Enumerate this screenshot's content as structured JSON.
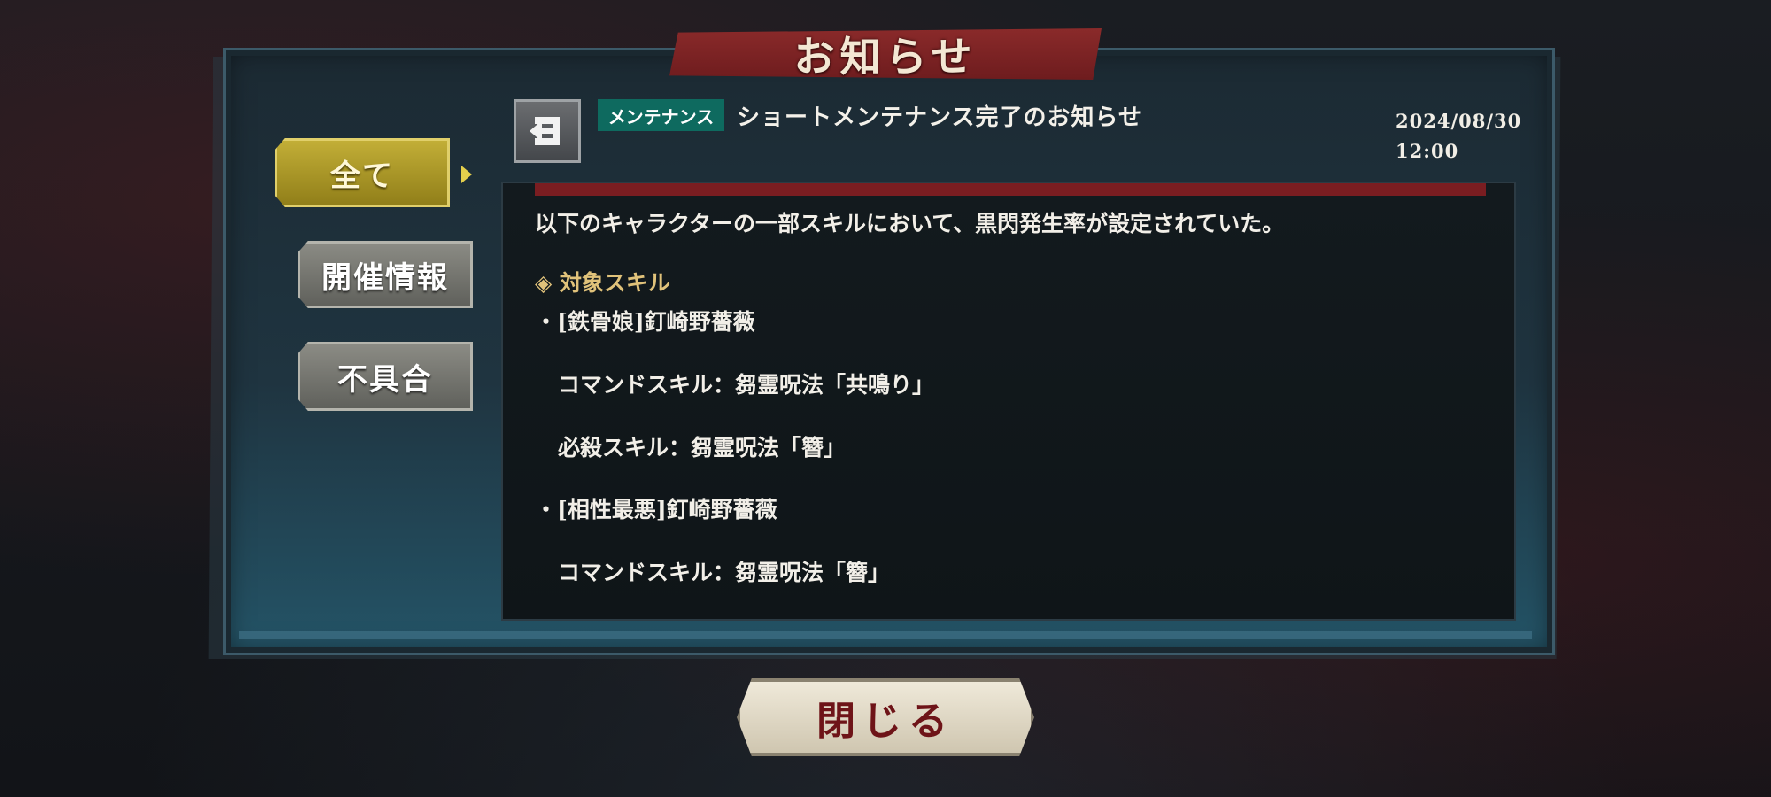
{
  "header": {
    "title": "お知らせ"
  },
  "tabs": [
    {
      "label": "全て",
      "active": true
    },
    {
      "label": "開催情報",
      "active": false
    },
    {
      "label": "不具合",
      "active": false
    }
  ],
  "notice": {
    "category": "メンテナンス",
    "title": "ショートメンテナンス完了のお知らせ",
    "date": "2024/08/30",
    "time": "12:00",
    "body": {
      "intro": "以下のキャラクターの一部スキルにおいて、黒閃発生率が設定されていた。",
      "section_heading": "◈ 対象スキル",
      "items": [
        "・[鉄骨娘]釘崎野薔薇",
        "コマンドスキル：芻霊呪法「共鳴り」",
        "必殺スキル：芻霊呪法「簪」",
        "・[相性最悪]釘崎野薔薇",
        "コマンドスキル：芻霊呪法「簪」"
      ]
    }
  },
  "footer": {
    "close_label": "閉じる"
  },
  "colors": {
    "accent_gold": "#c4b038",
    "category_teal": "#0e6a5f",
    "banner_red": "#7a1d21",
    "close_text": "#6e1418"
  },
  "icons": {
    "back": "return-arrow-icon",
    "tab_arrow": "triangle-right-icon"
  }
}
